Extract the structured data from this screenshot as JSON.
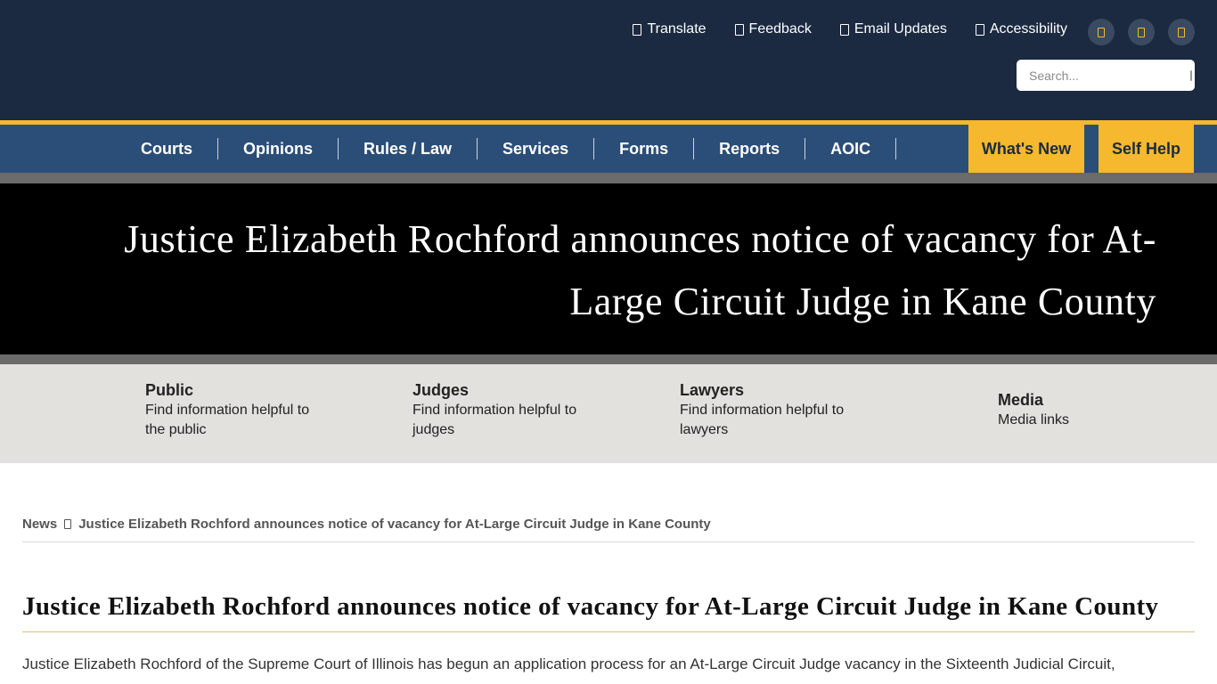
{
  "header": {
    "util_links": [
      {
        "label": "Translate",
        "icon": "globe-icon"
      },
      {
        "label": "Feedback",
        "icon": "comment-icon"
      },
      {
        "label": "Email Updates",
        "icon": "envelope-icon"
      },
      {
        "label": "Accessibility",
        "icon": "accessibility-icon"
      }
    ],
    "social_icons": [
      "facebook-icon",
      "twitter-icon",
      "youtube-icon"
    ],
    "search": {
      "placeholder": "Search...",
      "icon": "search-icon"
    }
  },
  "nav": {
    "items": [
      "Courts",
      "Opinions",
      "Rules / Law",
      "Services",
      "Forms",
      "Reports",
      "AOIC"
    ],
    "whats_new": "What's New",
    "self_help": "Self Help"
  },
  "banner": {
    "title": "Justice Elizabeth Rochford announces notice of vacancy for At-Large Circuit Judge in Kane County"
  },
  "audience": [
    {
      "title": "Public",
      "desc": "Find information helpful to the public"
    },
    {
      "title": "Judges",
      "desc": "Find information helpful to judges"
    },
    {
      "title": "Lawyers",
      "desc": "Find information helpful to lawyers"
    },
    {
      "title": "Media",
      "desc": "Media links"
    }
  ],
  "breadcrumb": {
    "root": "News",
    "current": "Justice Elizabeth Rochford announces notice of vacancy for At-Large Circuit Judge in Kane County"
  },
  "article": {
    "title": "Justice Elizabeth Rochford announces notice of vacancy for At-Large Circuit Judge in Kane County",
    "body": "Justice Elizabeth Rochford of the Supreme Court of Illinois has begun an application process for an At-Large Circuit Judge vacancy in the Sixteenth Judicial Circuit,"
  },
  "colors": {
    "header_bg": "#1b2a41",
    "nav_bg": "#2b4e78",
    "accent_gold": "#f5b82e",
    "banner_bg": "#000000",
    "audience_bg": "#e3e1de"
  }
}
